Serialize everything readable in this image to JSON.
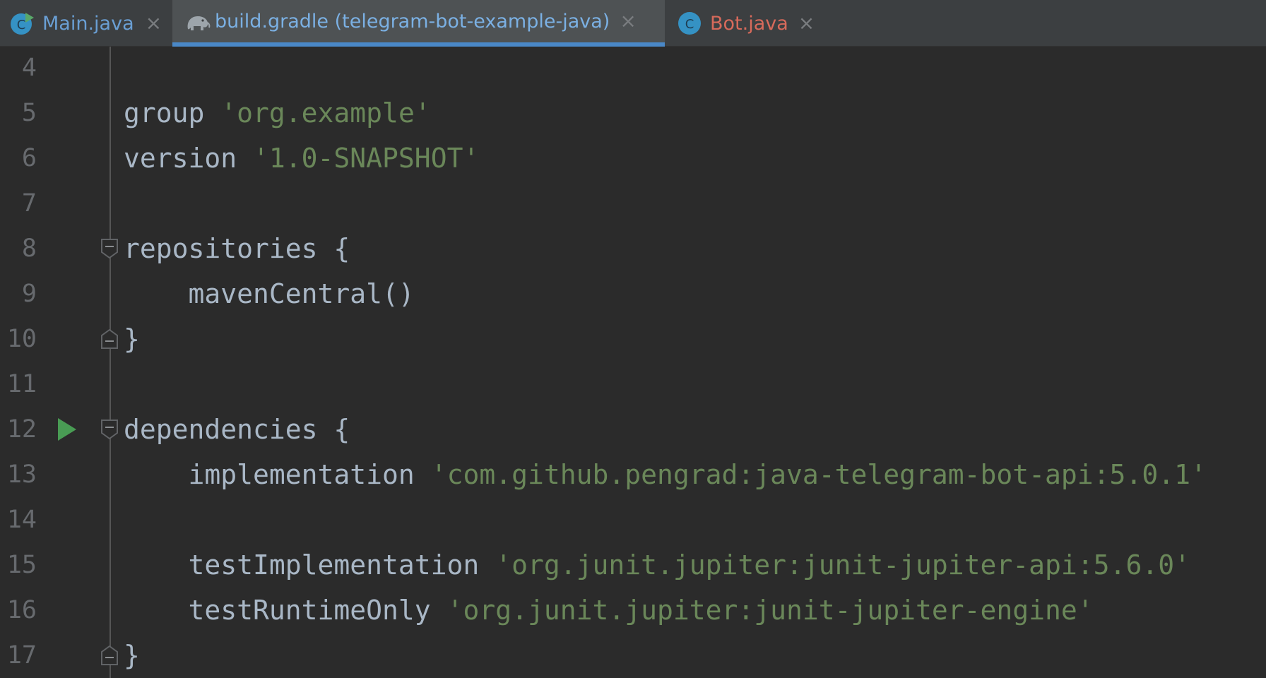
{
  "tabs": [
    {
      "label": "Main.java",
      "icon": "java-class-runnable-icon",
      "close": "×"
    },
    {
      "label": "build.gradle (telegram-bot-example-java)",
      "icon": "gradle-elephant-icon",
      "close": "×"
    },
    {
      "label": "Bot.java",
      "icon": "java-class-icon",
      "close": "×"
    }
  ],
  "colors": {
    "background": "#2b2b2b",
    "tabbar": "#3c3f41",
    "active_tab_underline": "#4a88c7",
    "string": "#6a8759",
    "identifier": "#a9b7c6",
    "line_number": "#676a6e",
    "run_icon": "#499c54",
    "error_tab_label": "#d76a5b"
  },
  "editor": {
    "lines": [
      {
        "num": "4",
        "ident": "",
        "str": ""
      },
      {
        "num": "5",
        "ident": "group ",
        "str": "'org.example'"
      },
      {
        "num": "6",
        "ident": "version ",
        "str": "'1.0-SNAPSHOT'"
      },
      {
        "num": "7",
        "ident": "",
        "str": ""
      },
      {
        "num": "8",
        "ident": "repositories {",
        "str": ""
      },
      {
        "num": "9",
        "ident": "    mavenCentral()",
        "str": ""
      },
      {
        "num": "10",
        "ident": "}",
        "str": ""
      },
      {
        "num": "11",
        "ident": "",
        "str": ""
      },
      {
        "num": "12",
        "ident": "dependencies {",
        "str": ""
      },
      {
        "num": "13",
        "ident": "    implementation ",
        "str": "'com.github.pengrad:java-telegram-bot-api:5.0.1'"
      },
      {
        "num": "14",
        "ident": "",
        "str": ""
      },
      {
        "num": "15",
        "ident": "    testImplementation ",
        "str": "'org.junit.jupiter:junit-jupiter-api:5.6.0'"
      },
      {
        "num": "16",
        "ident": "    testRuntimeOnly ",
        "str": "'org.junit.jupiter:junit-jupiter-engine'"
      },
      {
        "num": "17",
        "ident": "}",
        "str": ""
      }
    ]
  }
}
